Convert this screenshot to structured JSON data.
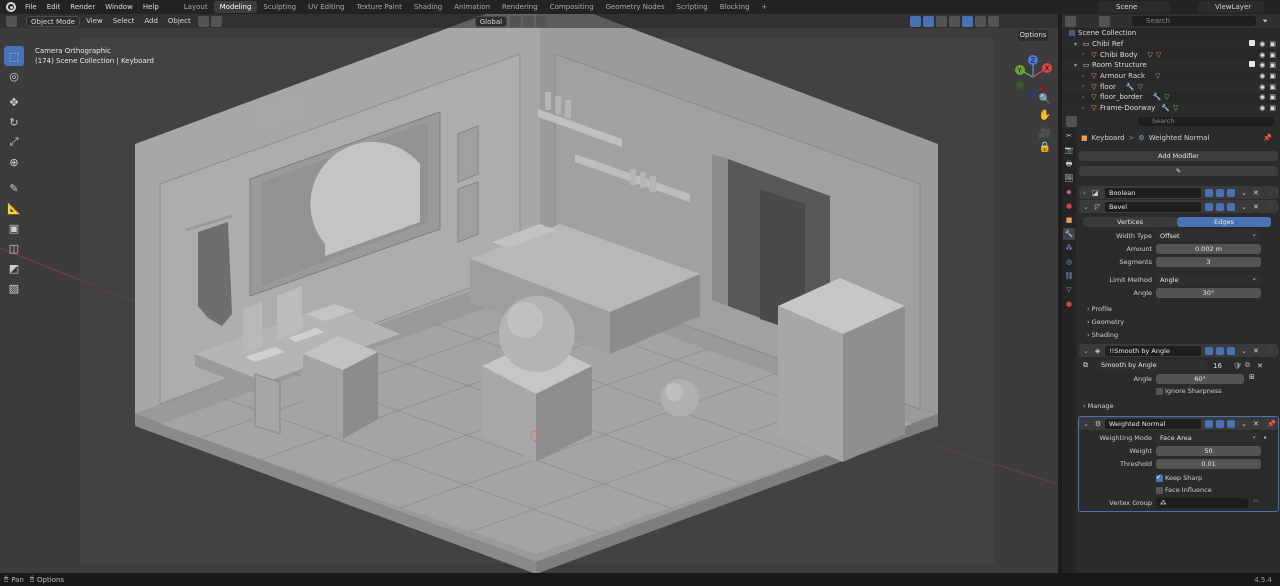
{
  "menu": [
    "File",
    "Edit",
    "Render",
    "Window",
    "Help"
  ],
  "workspaces": [
    "Layout",
    "Modeling",
    "Sculpting",
    "UV Editing",
    "Texture Paint",
    "Shading",
    "Animation",
    "Rendering",
    "Compositing",
    "Geometry Nodes",
    "Scripting",
    "Blocking"
  ],
  "workspace_plus": "+",
  "active_workspace": "Modeling",
  "scene": "Scene",
  "view_layer": "ViewLayer",
  "viewport": {
    "mode": "Object Mode",
    "menus": [
      "View",
      "Select",
      "Add",
      "Object"
    ],
    "transform_orientation": "Global",
    "camera_label": "Camera Orthographic",
    "collection_info": "(174) Scene Collection | Keyboard",
    "options_label": "Options"
  },
  "gizmo": {
    "x": "X",
    "y": "Y",
    "z": "Z"
  },
  "outliner": {
    "search_placeholder": "Search",
    "rows": [
      {
        "name": "Scene Collection"
      },
      {
        "name": "Chibi Ref"
      },
      {
        "name": "Chibi Body"
      },
      {
        "name": "Room Structure"
      },
      {
        "name": "Armour Rack"
      },
      {
        "name": "floor"
      },
      {
        "name": "floor_border"
      },
      {
        "name": "Frame-Doorway"
      }
    ]
  },
  "properties": {
    "search_placeholder": "Search",
    "breadcrumb_object": "Keyboard",
    "breadcrumb_sep": ">",
    "breadcrumb_modifier": "Weighted Normal",
    "add_modifier": "Add Modifier",
    "modifiers": {
      "boolean": "Boolean",
      "bevel": "Bevel",
      "smooth_group": "!!Smooth by Angle",
      "smooth_node": "Smooth by Angle",
      "smooth_users": "16",
      "weighted_normal": "Weighted Normal"
    },
    "bevel": {
      "tab_vertices": "Vertices",
      "tab_edges": "Edges",
      "width_type_label": "Width Type",
      "width_type": "Offset",
      "amount_label": "Amount",
      "amount": "0.002 m",
      "segments_label": "Segments",
      "segments": "3",
      "limit_method_label": "Limit Method",
      "limit_method": "Angle",
      "angle_label": "Angle",
      "angle": "30°",
      "profile": "Profile",
      "geometry": "Geometry",
      "shading": "Shading"
    },
    "smooth": {
      "angle_label": "Angle",
      "angle": "60°",
      "ignore_sharpness": "Ignore Sharpness",
      "manage": "Manage"
    },
    "weighted": {
      "mode_label": "Weighting Mode",
      "mode": "Face Area",
      "weight_label": "Weight",
      "weight": "50",
      "threshold_label": "Threshold",
      "threshold": "0.01",
      "keep_sharp": "Keep Sharp",
      "face_influence": "Face Influence",
      "vertex_group_label": "Vertex Group"
    }
  },
  "statusbar": {
    "pan": "Pan",
    "options": "Options",
    "version": "4.5.4"
  }
}
